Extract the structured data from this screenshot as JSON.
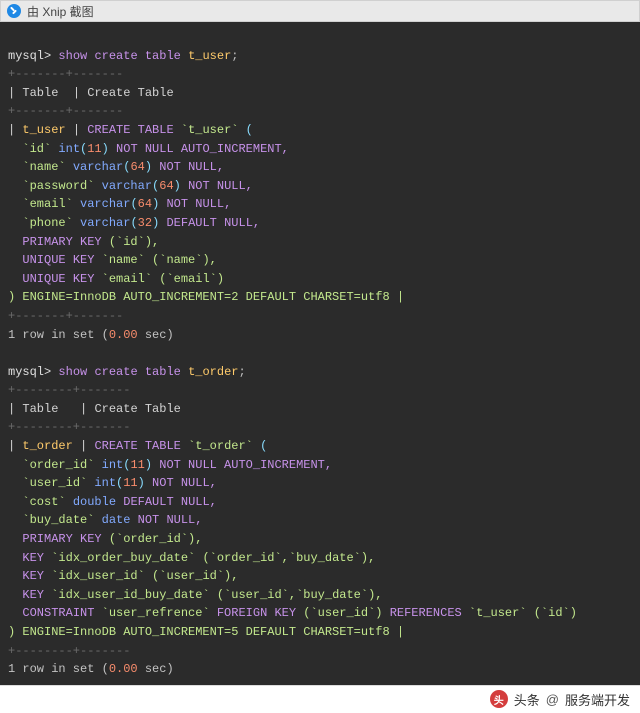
{
  "titlebar": {
    "label": "由 Xnip 截图"
  },
  "prompt": "mysql>",
  "cmd1": {
    "show": "show",
    "create": "create",
    "table": "table",
    "target": "t_user",
    "semi": ";"
  },
  "sep_top": "+-------+-------",
  "hdr": {
    "table": "Table",
    "create": "Create Table",
    "pipe": "|"
  },
  "tuser": {
    "name": "t_user",
    "create_kw": "CREATE TABLE",
    "bt_name": "`t_user`",
    "open": "(",
    "cols": {
      "id": {
        "col": "`id`",
        "type": "int",
        "arg": "11",
        "tail": "NOT NULL AUTO_INCREMENT,"
      },
      "name": {
        "col": "`name`",
        "type": "varchar",
        "arg": "64",
        "tail": "NOT NULL,"
      },
      "password": {
        "col": "`password`",
        "type": "varchar",
        "arg": "64",
        "tail": "NOT NULL,"
      },
      "email": {
        "col": "`email`",
        "type": "varchar",
        "arg": "64",
        "tail": "NOT NULL,"
      },
      "phone": {
        "col": "`phone`",
        "type": "varchar",
        "arg": "32",
        "tail_default": "DEFAULT",
        "tail_null": "NULL,"
      }
    },
    "pk": {
      "kw": "PRIMARY KEY",
      "cols": "(`id`),"
    },
    "uk1": {
      "kw": "UNIQUE KEY",
      "name": "`name`",
      "cols": "(`name`),"
    },
    "uk2": {
      "kw": "UNIQUE KEY",
      "name": "`email`",
      "cols": "(`email`)"
    },
    "engine_line": ") ENGINE=InnoDB AUTO_INCREMENT=2 DEFAULT CHARSET=utf8 |"
  },
  "result1": {
    "pre": "1 row in set (",
    "num": "0.00",
    "post": " sec)"
  },
  "cmd2": {
    "show": "show",
    "create": "create",
    "table": "table",
    "target": "t_order",
    "semi": ";"
  },
  "sep2_top": "+--------+-------",
  "hdr2": {
    "table": "Table",
    "create": "Create Table",
    "pipe": "|"
  },
  "torder": {
    "name": "t_order",
    "create_kw": "CREATE TABLE",
    "bt_name": "`t_order`",
    "open": "(",
    "cols": {
      "order_id": {
        "col": "`order_id`",
        "type": "int",
        "arg": "11",
        "tail": "NOT NULL AUTO_INCREMENT,"
      },
      "user_id": {
        "col": "`user_id`",
        "type": "int",
        "arg": "11",
        "tail": "NOT NULL,"
      },
      "cost": {
        "col": "`cost`",
        "type": "double",
        "tail_default": "DEFAULT",
        "tail_null": "NULL,"
      },
      "buy_date": {
        "col": "`buy_date`",
        "type": "date",
        "tail": "NOT NULL,"
      }
    },
    "pk": {
      "kw": "PRIMARY KEY",
      "cols": "(`order_id`),"
    },
    "k1": {
      "kw": "KEY",
      "name": "`idx_order_buy_date`",
      "cols": "(`order_id`,`buy_date`),"
    },
    "k2": {
      "kw": "KEY",
      "name": "`idx_user_id`",
      "cols": "(`user_id`),"
    },
    "k3": {
      "kw": "KEY",
      "name": "`idx_user_id_buy_date`",
      "cols": "(`user_id`,`buy_date`),"
    },
    "fk": {
      "kw": "CONSTRAINT",
      "name": "`user_refrence`",
      "fk_kw": "FOREIGN KEY",
      "cols": "(`user_id`)",
      "ref_kw": "REFERENCES",
      "ref_table": "`t_user`",
      "ref_cols": "(`id`)"
    },
    "engine_line": ") ENGINE=InnoDB AUTO_INCREMENT=5 DEFAULT CHARSET=utf8 |"
  },
  "result2": {
    "pre": "1 row in set (",
    "num": "0.00",
    "post": " sec)"
  },
  "footer": {
    "logo_text": "头",
    "prefix": "头条",
    "at": "@",
    "author": "服务端开发"
  }
}
